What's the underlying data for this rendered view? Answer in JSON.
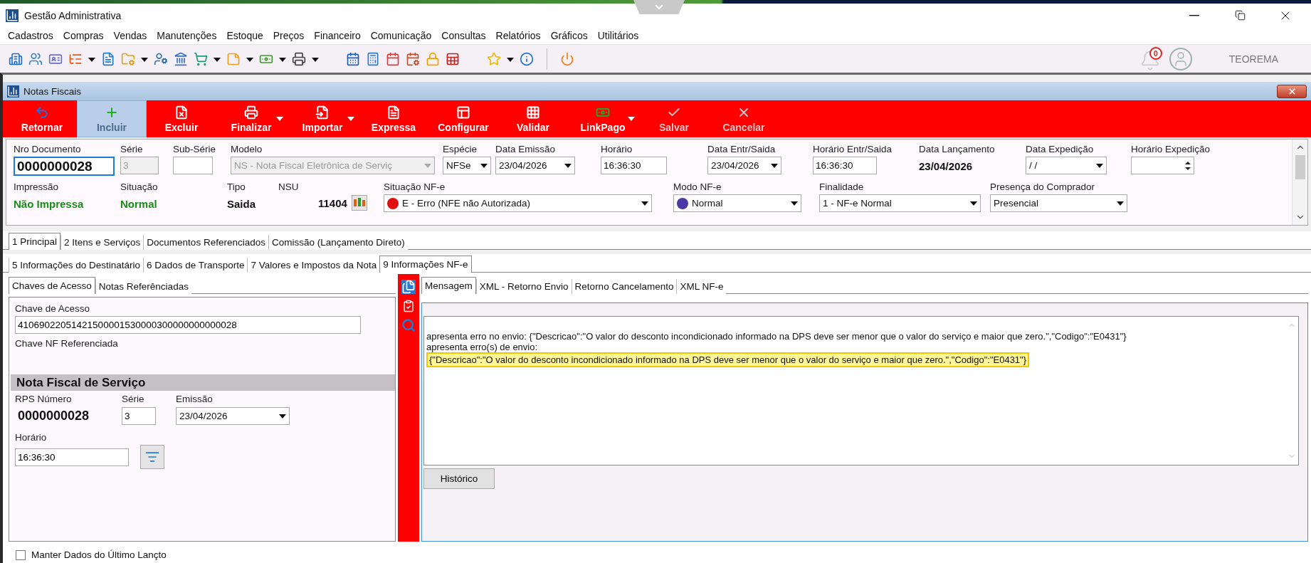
{
  "app": {
    "title": "Gestão Administrativa",
    "user": "TEOREMA",
    "notifications": "0"
  },
  "menu": [
    "Cadastros",
    "Compras",
    "Vendas",
    "Manutenções",
    "Estoque",
    "Preços",
    "Financeiro",
    "Comunicação",
    "Consultas",
    "Relatórios",
    "Gráficos",
    "Utilitários"
  ],
  "quick_toolbar": [
    [
      {
        "dropdown": false
      },
      {
        "dropdown": false
      },
      {
        "dropdown": false
      },
      {
        "dropdown": true
      },
      {
        "dropdown": false
      },
      {
        "dropdown": true
      },
      {
        "dropdown": false
      },
      {
        "dropdown": false
      },
      {
        "dropdown": true
      },
      {
        "dropdown": true
      },
      {
        "dropdown": true
      },
      {
        "dropdown": true
      }
    ],
    [
      {
        "dropdown": false
      },
      {
        "dropdown": false
      },
      {
        "dropdown": false
      },
      {
        "dropdown": false
      },
      {
        "dropdown": false
      },
      {
        "dropdown": false
      }
    ],
    [
      {
        "dropdown": true
      },
      {
        "dropdown": false
      }
    ],
    [
      {
        "dropdown": false
      }
    ]
  ],
  "window": {
    "title": "Notas Fiscais"
  },
  "actions": [
    {
      "label": "Retornar",
      "selected": false,
      "disabled": false,
      "dropdown": false
    },
    {
      "label": "Incluir",
      "selected": true,
      "disabled": true,
      "dropdown": false
    },
    {
      "label": "Excluir",
      "selected": false,
      "disabled": false,
      "dropdown": false
    },
    {
      "label": "Finalizar",
      "selected": false,
      "disabled": false,
      "dropdown": true
    },
    {
      "label": "Importar",
      "selected": false,
      "disabled": false,
      "dropdown": true
    },
    {
      "label": "Expressa",
      "selected": false,
      "disabled": false,
      "dropdown": false
    },
    {
      "label": "Configurar",
      "selected": false,
      "disabled": false,
      "dropdown": false
    },
    {
      "label": "Validar",
      "selected": false,
      "disabled": false,
      "dropdown": false
    },
    {
      "label": "LinkPago",
      "selected": false,
      "disabled": false,
      "dropdown": true
    },
    {
      "label": "Salvar",
      "selected": false,
      "disabled": true,
      "dropdown": false
    },
    {
      "label": "Cancelar",
      "selected": false,
      "disabled": true,
      "dropdown": false
    }
  ],
  "header": [
    [
      {
        "label": "Nro Documento",
        "kind": "input",
        "value": "0000000028",
        "disabled": false,
        "focused": true
      },
      {
        "label": "Série",
        "kind": "input",
        "value": "3",
        "disabled": true,
        "focused": false
      },
      {
        "label": "Sub-Série",
        "kind": "input",
        "disabled": false,
        "focused": false
      },
      {
        "label": "Modelo",
        "kind": "select",
        "value": "NS - Nota Fiscal Eletrônica de Serviç",
        "disabled": true
      },
      {
        "label": "Espécie",
        "kind": "select",
        "value": "NFSe",
        "disabled": false
      },
      {
        "label": "Data Emissão",
        "kind": "select",
        "value": "23/04/2026",
        "disabled": false
      },
      {
        "label": "Horário",
        "kind": "input",
        "value": "16:36:30",
        "disabled": false,
        "focused": false
      },
      {
        "label": "Data Entr/Saida",
        "kind": "select",
        "value": "23/04/2026",
        "disabled": false
      },
      {
        "label": "Horário Entr/Saida",
        "kind": "input",
        "value": "16:36:30",
        "disabled": false,
        "focused": false
      },
      {
        "label": "Data Lançamento",
        "kind": "text",
        "value": "23/04/2026"
      },
      {
        "label": "Data Expedição",
        "kind": "select",
        "value": " / /",
        "disabled": false
      },
      {
        "label": "Horário Expedição",
        "kind": "spin",
        "disabled": false
      }
    ],
    [
      {
        "label": "Impressão",
        "kind": "text",
        "value": "Não Impressa",
        "color": "#1a8c1a"
      },
      {
        "label": "Situação",
        "kind": "text",
        "value": "Normal",
        "color": "#1a8c1a"
      },
      {
        "label": "Tipo",
        "kind": "text",
        "value": "Saida"
      },
      {
        "label": "NSU",
        "kind": "counter",
        "value": "11404"
      },
      {
        "label": "Situação NF-e",
        "kind": "select",
        "value": "E - Erro (NFE não Autorizada)",
        "color": "#e01010",
        "disabled": false
      },
      {
        "label": "Modo NF-e",
        "kind": "select",
        "value": "Normal",
        "color": "#4a3aa8",
        "disabled": false
      },
      {
        "label": "Finalidade",
        "kind": "select",
        "value": "1 - NF-e Normal",
        "disabled": false
      },
      {
        "label": "Presença do Comprador",
        "kind": "select",
        "value": "Presencial",
        "disabled": false
      }
    ]
  ],
  "tabs": [
    [
      {
        "label": "1 Principal",
        "selected": true
      },
      {
        "label": "2 Itens e Serviços",
        "selected": false
      },
      {
        "label": "Documentos Referenciados",
        "selected": false
      },
      {
        "label": "Comissão (Lançamento Direto)",
        "selected": false
      }
    ],
    [
      {
        "label": "5 Informações do Destinatário",
        "selected": false
      },
      {
        "label": "6 Dados de Transporte",
        "selected": false
      },
      {
        "label": "7 Valores e Impostos da Nota",
        "selected": false
      },
      {
        "label": "9 Informações NF-e",
        "selected": true
      }
    ]
  ],
  "left_tabs": [
    {
      "label": "Chaves de Acesso",
      "selected": true
    },
    {
      "label": "Notas Referênciadas",
      "selected": false
    }
  ],
  "access": {
    "key_label": "Chave de Acesso",
    "key_value": "41069022051421500001530000300000000000028",
    "ref_label": "Chave NF Referenciada"
  },
  "service": {
    "title": "Nota Fiscal de Serviço",
    "rps_label": "RPS Número",
    "rps_value": "0000000028",
    "serie_label": "Série",
    "serie_value": "3",
    "emissao_label": "Emissão",
    "emissao_value": "23/04/2026",
    "time_label": "Horário",
    "time_value": "16:36:30"
  },
  "right_tabs": [
    {
      "label": "Mensagem",
      "selected": true
    },
    {
      "label": "XML - Retorno Envio",
      "selected": false
    },
    {
      "label": "Retorno Cancelamento",
      "selected": false
    },
    {
      "label": "XML NF-e",
      "selected": false
    }
  ],
  "message": [
    {
      "text": "apresenta erro no envio: {\"Descricao\":\"O valor do desconto incondicionado informado na DPS deve ser menor que o valor do serviço e maior que zero.\",\"Codigo\":\"E0431\"}",
      "highlighted": false
    },
    {
      "text": "apresenta erro(s) de envio:",
      "highlighted": false
    },
    {
      "text": "{\"Descricao\":\"O valor do desconto incondicionado informado na DPS deve ser menor que o valor do serviço e maior que zero.\",\"Codigo\":\"E0431\"}",
      "highlighted": true
    }
  ],
  "history_button": "Histórico",
  "keep_data": {
    "label": "Manter Dados do Último Lançto",
    "checked": false
  }
}
